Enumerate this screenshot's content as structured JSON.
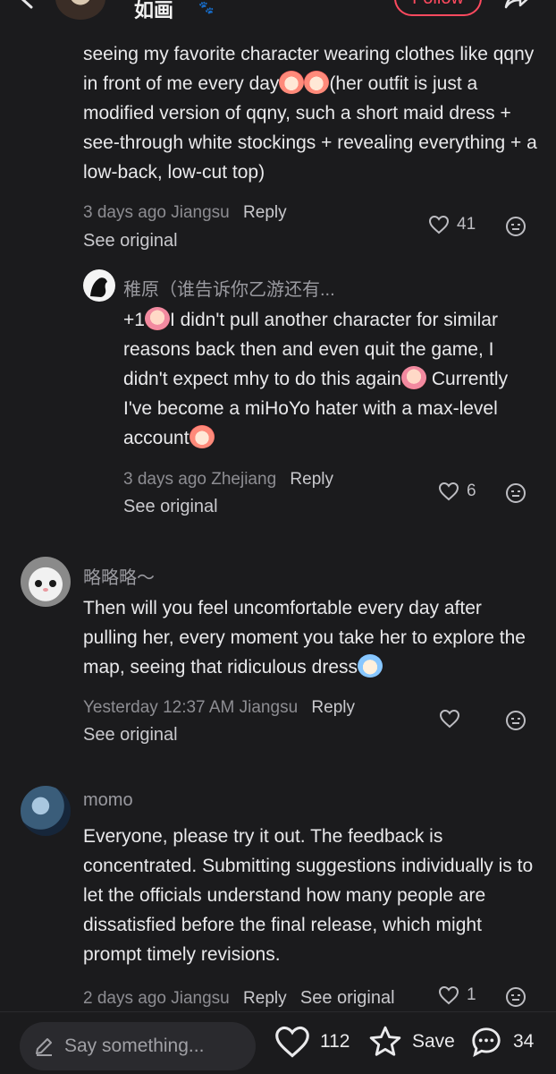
{
  "header": {
    "username": "如画",
    "follow_label": "Follow"
  },
  "comments": [
    {
      "text_parts": [
        "seeing my favorite character wearing clothes like qqny in front of me every day",
        "(her outfit is just a modified version of qqny, such a short maid dress + see-through white stockings + revealing everything + a low-back, low-cut top)"
      ],
      "time": "3 days ago",
      "location": "Jiangsu",
      "reply_label": "Reply",
      "see_original": "See original",
      "likes": "41"
    },
    {
      "username": "稚原（谁告诉你乙游还有...",
      "text_parts": [
        "+1",
        "I didn't pull another character for similar reasons back then and even quit the game, I didn't expect mhy to do this again",
        "Currently I've become a miHoYo hater with a max-level account"
      ],
      "time": "3 days ago",
      "location": "Zhejiang",
      "reply_label": "Reply",
      "see_original": "See original",
      "likes": "6"
    },
    {
      "username": "略略略～",
      "text": "Then will you feel uncomfortable every day after pulling her, every moment you take her to explore the map, seeing that ridiculous dress",
      "time": "Yesterday 12:37 AM",
      "location": "Jiangsu",
      "reply_label": "Reply",
      "see_original": "See original",
      "likes": ""
    },
    {
      "username": "momo",
      "text": "Everyone, please try it out. The feedback is concentrated. Submitting suggestions individually is to let the officials understand how many people are dissatisfied before the final release, which might prompt timely revisions.",
      "time": "2 days ago",
      "location": "Jiangsu",
      "reply_label": "Reply",
      "see_original": "See original",
      "likes": "1"
    }
  ],
  "bottom_bar": {
    "placeholder": "Say something...",
    "likes": "112",
    "save_label": "Save",
    "comments": "34"
  },
  "colors": {
    "background": "#1b1b1d",
    "follow": "#ff4a5f",
    "muted": "#8d8d92"
  }
}
